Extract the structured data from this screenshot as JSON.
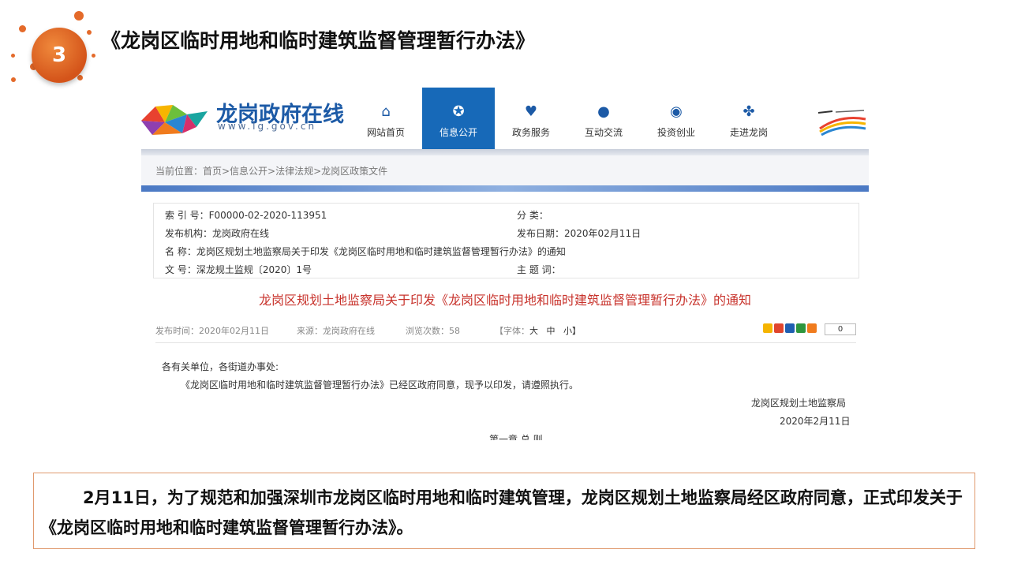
{
  "slide": {
    "badge_number": "3",
    "title": "《龙岗区临时用地和临时建筑监督管理暂行办法》"
  },
  "website": {
    "logo_title": "龙岗政府在线",
    "logo_url": "www.lg.gov.cn",
    "nav": [
      {
        "label": "网站首页",
        "icon": "home-icon",
        "active": false
      },
      {
        "label": "信息公开",
        "icon": "star-icon",
        "active": true
      },
      {
        "label": "政务服务",
        "icon": "heart-icon",
        "active": false
      },
      {
        "label": "互动交流",
        "icon": "chat-icon",
        "active": false
      },
      {
        "label": "投资创业",
        "icon": "compass-icon",
        "active": false
      },
      {
        "label": "走进龙岗",
        "icon": "clover-icon",
        "active": false
      }
    ],
    "breadcrumb": "当前位置：首页>信息公开>法律法规>龙岗区政策文件",
    "meta": {
      "index_no": "索 引 号：F00000-02-2020-113951",
      "category": "分 类：",
      "publisher": "发布机构：龙岗政府在线",
      "publish_date": "发布日期：2020年02月11日",
      "name": "名 称：龙岗区规划土地监察局关于印发《龙岗区临时用地和临时建筑监督管理暂行办法》的通知",
      "doc_no": "文 号：深龙规土监规〔2020〕1号",
      "subject": "主 题 词："
    },
    "doc_title": "龙岗区规划土地监察局关于印发《龙岗区临时用地和临时建筑监督管理暂行办法》的通知",
    "info": {
      "publish_time": "发布时间：2020年02月11日",
      "source": "来源：龙岗政府在线",
      "views": "浏览次数：58",
      "font_label": "【字体：",
      "font_large": "大",
      "font_medium": "中",
      "font_small": "小】",
      "share_count": "0"
    },
    "body": {
      "salutation": "各有关单位，各街道办事处:",
      "paragraph": "《龙岗区临时用地和临时建筑监督管理暂行办法》已经区政府同意，现予以印发，请遵照执行。",
      "signature": "龙岗区规划土地监察局",
      "date": "2020年2月11日",
      "chapter": "第一章 总 则"
    }
  },
  "summary": {
    "text": "2月11日，为了规范和加强深圳市龙岗区临时用地和临时建筑管理，龙岗区规划土地监察局经区政府同意，正式印发关于《龙岗区临时用地和临时建筑监督管理暂行办法》。"
  },
  "colors": {
    "accent_orange": "#e46a2a",
    "nav_active": "#1769b8",
    "doc_title_red": "#c8332c",
    "summary_border": "#e09a6e"
  }
}
